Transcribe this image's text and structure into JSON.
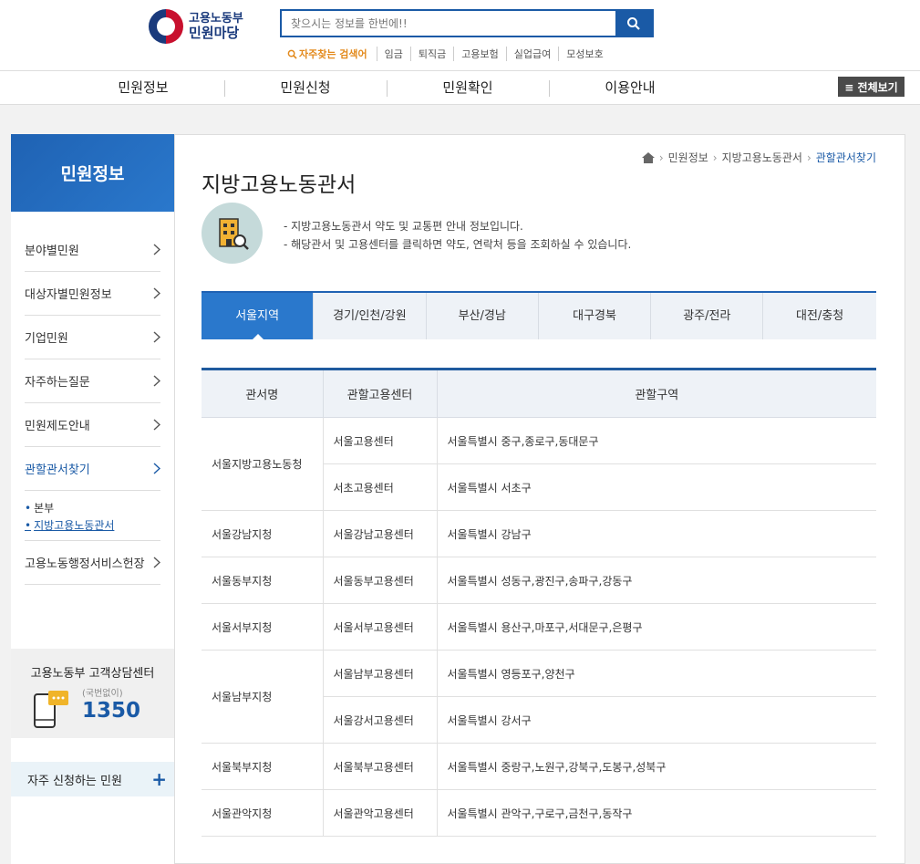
{
  "header": {
    "logo_top": "고용노동부",
    "logo_bottom": "민원마당",
    "search_placeholder": "찾으시는 정보를 한번에!!",
    "hot_label": "자주찾는 검색어",
    "keywords": [
      "임금",
      "퇴직금",
      "고용보험",
      "실업급여",
      "모성보호"
    ]
  },
  "gnb": {
    "items": [
      "민원정보",
      "민원신청",
      "민원확인",
      "이용안내"
    ],
    "allview": "≡ 전체보기"
  },
  "lnb": {
    "title": "민원정보",
    "items": [
      "분야별민원",
      "대상자별민원정보",
      "기업민원",
      "자주하는질문",
      "민원제도안내",
      "관할관서찾기"
    ],
    "sub": [
      "본부",
      "지방고용노동관서"
    ],
    "last_item": "고용노동행정서비스헌장",
    "call_title": "고용노동부 고객상담센터",
    "call_sub": "(국번없이)",
    "call_number": "1350",
    "freq": "자주 신청하는 민원",
    "freq_plus": "+"
  },
  "breadcrumb": [
    "민원정보",
    "지방고용노동관서",
    "관할관서찾기"
  ],
  "page_title": "지방고용노동관서",
  "intro": [
    "- 지방고용노동관서 약도 및 교통편 안내 정보입니다.",
    "- 해당관서 및 고용센터를 클릭하면 약도, 연락처 등을 조회하실 수 있습니다."
  ],
  "tabs": [
    "서울지역",
    "경기/인천/강원",
    "부산/경남",
    "대구경북",
    "광주/전라",
    "대전/충청"
  ],
  "table": {
    "headers": [
      "관서명",
      "관할고용센터",
      "관할구역"
    ],
    "rows": [
      {
        "office": "서울지방고용노동청",
        "center": "서울고용센터",
        "area": "서울특별시 중구,종로구,동대문구"
      },
      {
        "office": "",
        "center": "서초고용센터",
        "area": "서울특별시 서초구"
      },
      {
        "office": "서울강남지청",
        "center": "서울강남고용센터",
        "area": "서울특별시 강남구"
      },
      {
        "office": "서울동부지청",
        "center": "서울동부고용센터",
        "area": "서울특별시 성동구,광진구,송파구,강동구"
      },
      {
        "office": "서울서부지청",
        "center": "서울서부고용센터",
        "area": "서울특별시 용산구,마포구,서대문구,은평구"
      },
      {
        "office": "서울남부지청",
        "center": "서울남부고용센터",
        "area": "서울특별시 영등포구,양천구"
      },
      {
        "office": "",
        "center": "서울강서고용센터",
        "area": "서울특별시 강서구"
      },
      {
        "office": "서울북부지청",
        "center": "서울북부고용센터",
        "area": "서울특별시 중랑구,노원구,강북구,도봉구,성북구"
      },
      {
        "office": "서울관악지청",
        "center": "서울관악고용센터",
        "area": "서울특별시 관악구,구로구,금천구,동작구"
      }
    ]
  }
}
